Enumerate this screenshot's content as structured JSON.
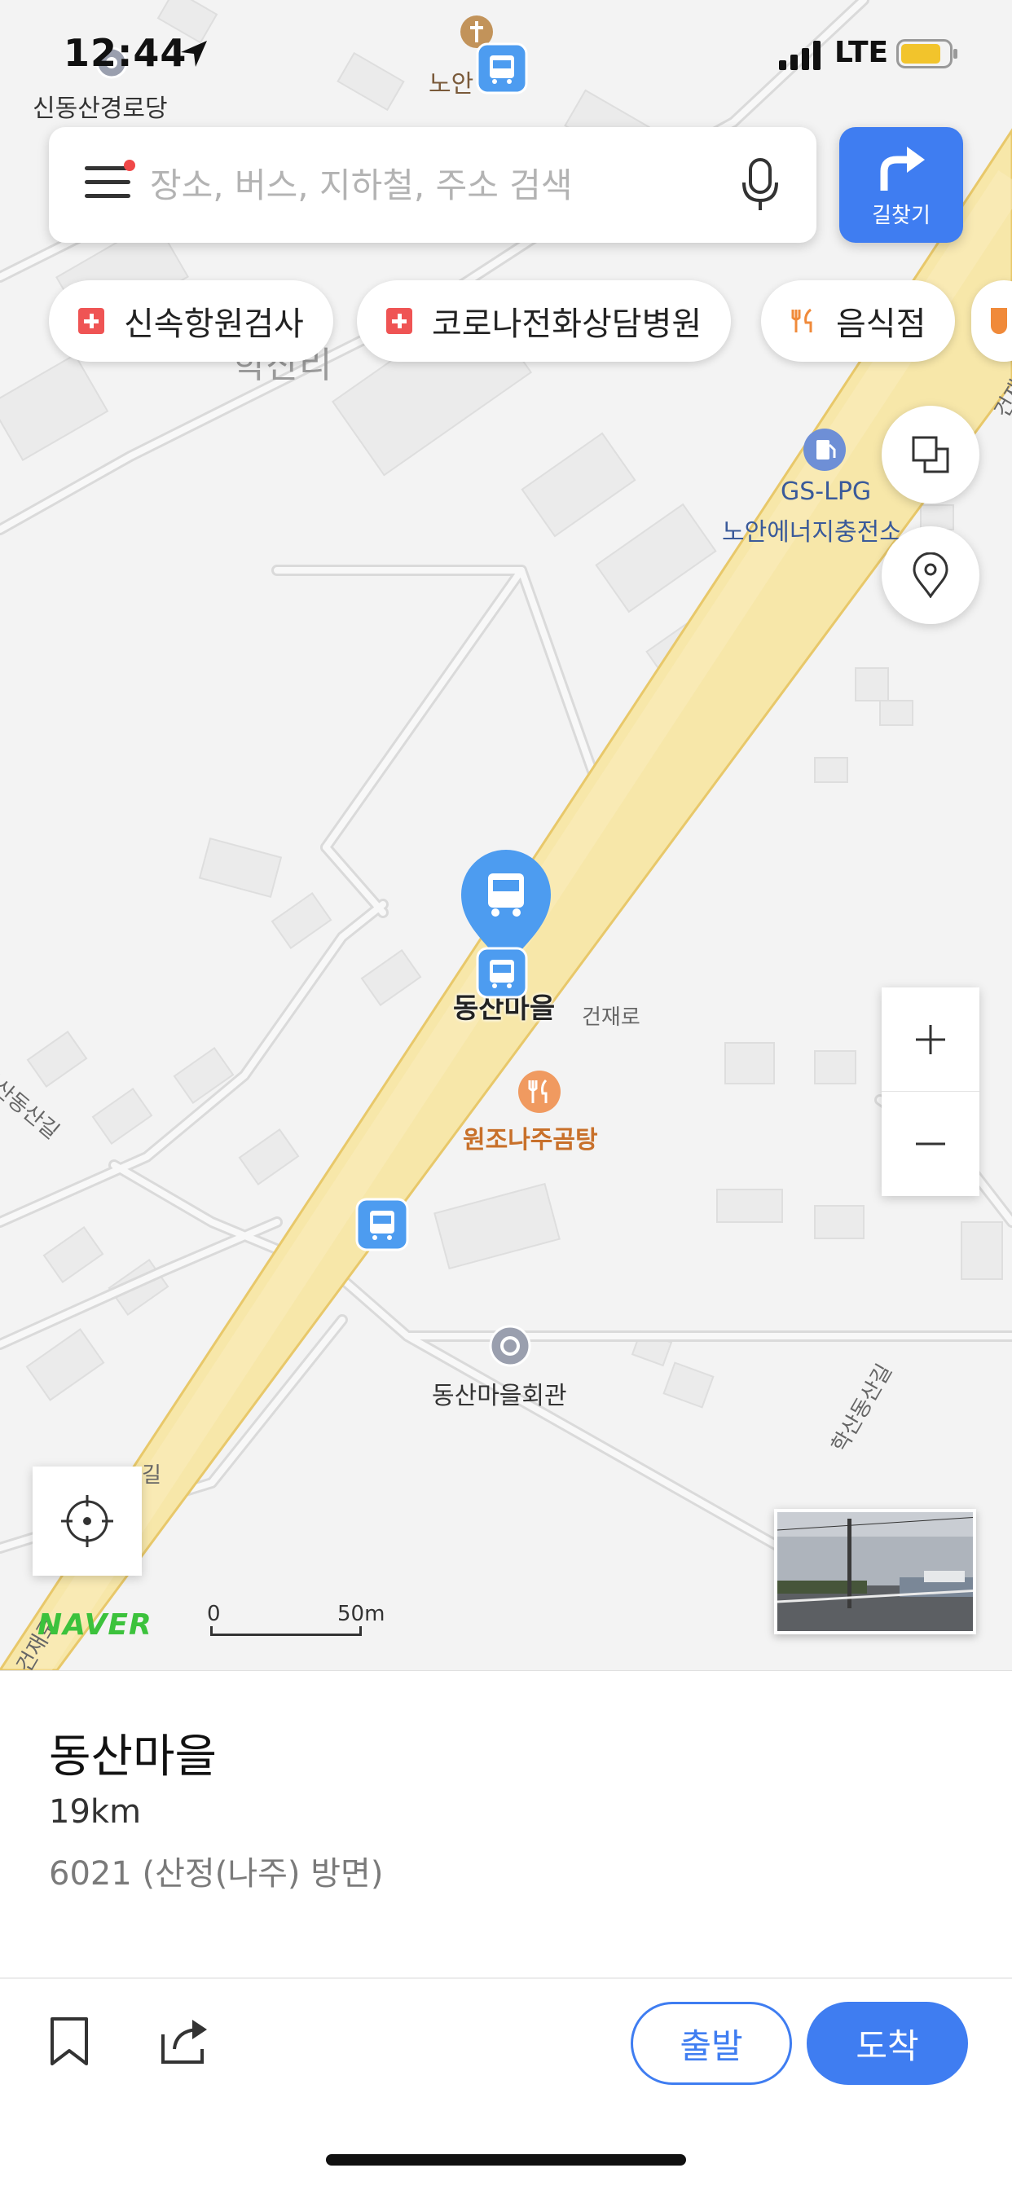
{
  "status_bar": {
    "time": "12:44",
    "network": "LTE"
  },
  "search": {
    "placeholder": "장소, 버스, 지하철, 주소 검색"
  },
  "route_button": {
    "label": "길찾기"
  },
  "chips": [
    {
      "label": "신속항원검사",
      "icon": "hospital-icon"
    },
    {
      "label": "코로나전화상담병원",
      "icon": "hospital-icon"
    },
    {
      "label": "음식점",
      "icon": "restaurant-icon"
    }
  ],
  "map": {
    "labels": {
      "top_left_place": "신동산경로당",
      "top_place": "노안",
      "faint_village": "학산리",
      "gas_station_line1": "GS-LPG",
      "gas_station_line2": "노안에너지충전소",
      "selected_stop": "동산마을",
      "road_main": "건재로",
      "road_main_bottom": "건재로",
      "road_left": "학산동산길",
      "road_right": "학산동산길",
      "road_bottom_left": "길",
      "restaurant": "원조나주곰탕",
      "hall": "동산마을회관",
      "road_top_right": "건재"
    },
    "brand": "NAVER",
    "scale": {
      "zero": "0",
      "distance": "50m"
    },
    "colors": {
      "road_main": "#f7e7a9",
      "road_edge": "#e8c86a",
      "bus_pin": "#4d9cf0",
      "accent": "#3f7df1"
    }
  },
  "place": {
    "name": "동산마을",
    "distance": "19km",
    "direction": "6021 (산정(나주) 방면)"
  },
  "actions": {
    "depart": "출발",
    "arrive": "도착"
  }
}
